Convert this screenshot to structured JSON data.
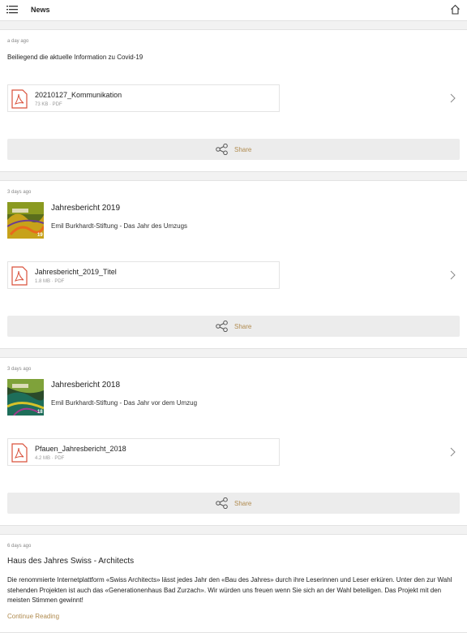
{
  "header": {
    "title": "News",
    "menu_icon": "menu-icon",
    "home_icon": "home-icon"
  },
  "accent_color": "#b08b4f",
  "posts": [
    {
      "timestamp": "a day ago",
      "text": "Beiliegend die aktuelle Information zu Covid-19",
      "attachment": {
        "name": "20210127_Kommunikation",
        "meta": "73 KB · PDF",
        "icon": "pdf-icon"
      },
      "share_label": "Share"
    },
    {
      "timestamp": "3 days ago",
      "title": "Jahresbericht 2019",
      "subtitle": "Emil Burkhardt-Stiftung - Das Jahr des Umzugs",
      "thumb_badge": "19",
      "attachment": {
        "name": "Jahresbericht_2019_Titel",
        "meta": "1.8 MB · PDF",
        "icon": "pdf-icon"
      },
      "share_label": "Share"
    },
    {
      "timestamp": "3 days ago",
      "title": "Jahresbericht 2018",
      "subtitle": "Emil Burkhardt-Stiftung - Das Jahr vor dem Umzug",
      "thumb_badge": "18",
      "attachment": {
        "name": "Pfauen_Jahresbericht_2018",
        "meta": "4.2 MB · PDF",
        "icon": "pdf-icon"
      },
      "share_label": "Share"
    },
    {
      "timestamp": "6 days ago",
      "title": "Haus des Jahres Swiss - Architects",
      "body": "Die renommierte Internetplattform «Swiss Architects» lässt jedes Jahr den «Bau des Jahres» durch ihre Leserinnen und Leser erküren. Unter den zur Wahl stehenden Projekten ist auch das «Generationenhaus Bad Zurzach». Wir würden uns freuen wenn Sie sich an der Wahl beteiligen. Das Projekt mit den meisten Stimmen gewinnt!",
      "continue_label": "Continue Reading"
    }
  ]
}
